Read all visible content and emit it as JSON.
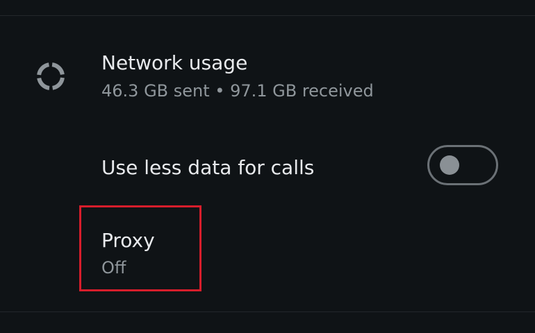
{
  "network_usage": {
    "title": "Network usage",
    "summary": "46.3 GB sent • 97.1 GB received",
    "icon": "data-usage-ring-icon"
  },
  "calls_data_saver": {
    "label": "Use less data for calls",
    "toggle_on": false
  },
  "proxy": {
    "title": "Proxy",
    "status": "Off",
    "highlight_color": "#d71d2b"
  },
  "colors": {
    "background": "#0f1316",
    "primary_text": "#e8eaed",
    "secondary_text": "#8f969b"
  }
}
